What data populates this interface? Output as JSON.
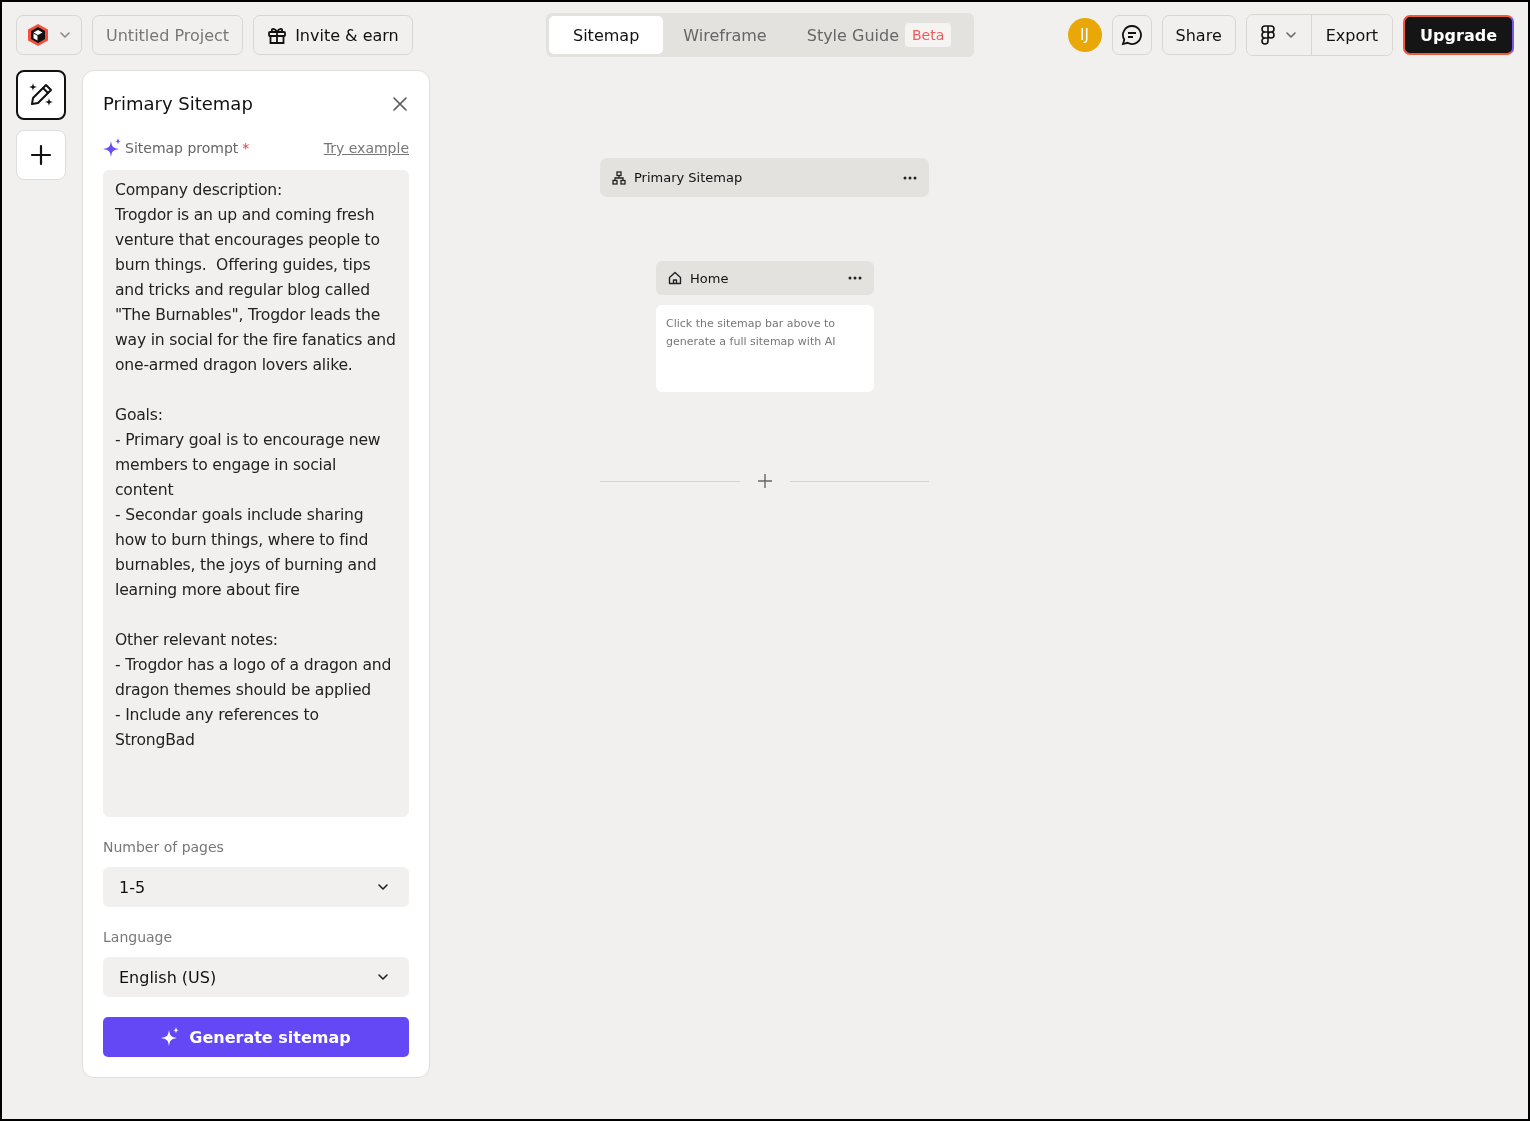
{
  "topbar": {
    "project_name": "Untitled Project",
    "invite_button": "Invite & earn",
    "tabs": [
      {
        "label": "Sitemap",
        "selected": true
      },
      {
        "label": "Wireframe",
        "selected": false
      },
      {
        "label": "Style Guide",
        "selected": false,
        "badge": "Beta"
      }
    ],
    "avatar": "IJ",
    "share_button": "Share",
    "export_button": "Export",
    "upgrade_button": "Upgrade"
  },
  "panel": {
    "title": "Primary Sitemap",
    "prompt_label": "Sitemap prompt",
    "prompt_required": true,
    "required_mark": "*",
    "try_example": "Try example",
    "prompt_value": "Company description:\nTrogdor is an up and coming fresh venture that encourages people to burn things.  Offering guides, tips and tricks and regular blog called \"The Burnables\", Trogdor leads the way in social for the fire fanatics and one-armed dragon lovers alike.\n\nGoals:\n- Primary goal is to encourage new members to engage in social content\n- Secondar goals include sharing how to burn things, where to find burnables, the joys of burning and learning more about fire\n\nOther relevant notes:\n- Trogdor has a logo of a dragon and dragon themes should be applied\n- Include any references to StrongBad",
    "fields": [
      {
        "label": "Number of pages",
        "value": "1-5"
      },
      {
        "label": "Language",
        "value": "English (US)"
      }
    ],
    "generate_button": "Generate sitemap"
  },
  "canvas": {
    "sitemap_bar": "Primary Sitemap",
    "page": {
      "title": "Home",
      "hint": "Click the sitemap bar above to generate a full sitemap with AI"
    }
  }
}
